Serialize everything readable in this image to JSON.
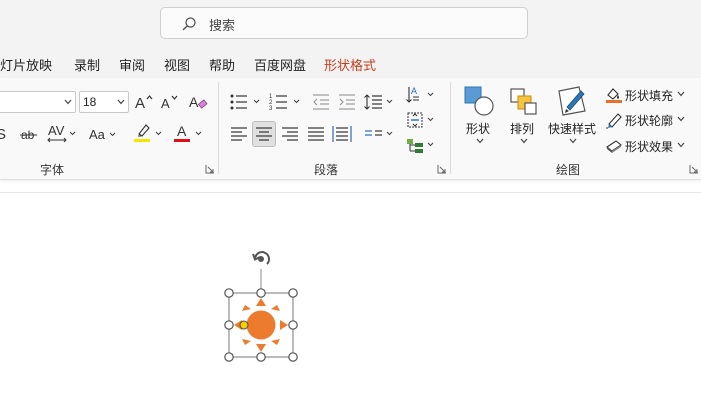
{
  "search": {
    "label": "搜索"
  },
  "tabs": [
    {
      "label": "灯片放映",
      "active": false
    },
    {
      "label": "录制",
      "active": false
    },
    {
      "label": "审阅",
      "active": false
    },
    {
      "label": "视图",
      "active": false
    },
    {
      "label": "帮助",
      "active": false
    },
    {
      "label": "百度网盘",
      "active": false
    },
    {
      "label": "形状格式",
      "active": true
    }
  ],
  "font_group": {
    "label": "字体",
    "font_size": "18",
    "buttons": [
      "bold-partial-icon",
      "strikethrough-icon",
      "character-spacing-icon",
      "change-case-icon",
      "highlight-icon",
      "font-color-icon",
      "grow-font-icon",
      "shrink-font-icon",
      "clear-formatting-icon"
    ],
    "highlight_color": "#f5e600",
    "font_color": "#e0101a"
  },
  "paragraph_group": {
    "label": "段落",
    "selected_alignment": "center"
  },
  "drawing_group": {
    "label": "绘图",
    "shapes_label": "形状",
    "arrange_label": "排列",
    "quick_styles_label": "快速样式",
    "fill_label": "形状填充",
    "outline_label": "形状轮廓",
    "effects_label": "形状效果",
    "fill_color": "#e8702a"
  },
  "colors": {
    "accent": "#c43e1c",
    "sun": "#ec7b2d",
    "handle_yellow": "#f5d000"
  }
}
